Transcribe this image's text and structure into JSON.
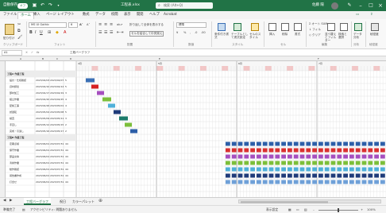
{
  "titlebar": {
    "autosave_label": "自動保存",
    "autosave_state": "オフ",
    "filename": "工程表.xlsx",
    "search_placeholder": "検索 (Alt+Q)",
    "user_name": "佐藤 陽"
  },
  "menu": [
    "ファイル",
    "ホーム",
    "挿入",
    "ページ レイアウト",
    "数式",
    "データ",
    "校閲",
    "表示",
    "開発",
    "ヘルプ",
    "Acrobat"
  ],
  "ribbon": {
    "paste_label": "貼り付け",
    "font_name": "MS UI Gothic",
    "font_size": "6",
    "wrap_text": "折り返して全体を表示する",
    "merge_center": "セルを結合して中央揃え",
    "number_format": "標準",
    "cond_format": "条件付き書式",
    "format_table": "テーブルとして書式設定",
    "cell_styles": "セルのスタイル",
    "insert": "挿入",
    "delete": "削除",
    "format": "書式",
    "autosum": "オート SUM",
    "fill": "フィル",
    "clear": "クリア",
    "sort_filter": "並べ替えとフィルター",
    "find_select": "検索と選択",
    "analyze": "データ分析",
    "sensitivity": "秘密度",
    "groups": [
      "クリップボード",
      "フォント",
      "配置",
      "数値",
      "スタイル",
      "セル",
      "編集",
      "分析",
      "秘密度"
    ]
  },
  "formula_bar": {
    "name_box": "A1",
    "fx": "fx",
    "content": "工程バーグラフ"
  },
  "sheet": {
    "col_headers": [
      "A",
      "B",
      "C",
      "D",
      "E",
      "F"
    ],
    "month_labels": [
      "4月",
      "5月",
      "6月",
      "7月"
    ],
    "rows": [
      {
        "label": "工程A\n作業工程",
        "bold": true
      },
      {
        "label": "設計・仕様確認",
        "start": "2023/04/03",
        "end": "2023/04/07",
        "days": "5"
      },
      {
        "label": "資材調達",
        "start": "2023/04/10",
        "end": "2023/04/14",
        "days": "5"
      },
      {
        "label": "部材加工",
        "start": "2023/04/17",
        "end": "2023/04/19",
        "days": "3"
      },
      {
        "label": "組立作業",
        "start": "2023/04/20",
        "end": "2023/04/25",
        "days": "4"
      },
      {
        "label": "配線工事",
        "start": "2023/04/26",
        "end": "2023/05/01",
        "days": "4"
      },
      {
        "label": "試運転",
        "start": "2023/05/02",
        "end": "2023/05/08",
        "days": "5"
      },
      {
        "label": "検査",
        "start": "2023/05/09",
        "end": "2023/05/11",
        "days": "3"
      },
      {
        "label": "手直し",
        "start": "2023/05/12",
        "end": "2023/05/15",
        "days": "2"
      },
      {
        "label": "完成・引渡し",
        "start": "2023/05/16",
        "end": "2023/05/17",
        "days": "2"
      },
      {
        "label": "工程B\n作業工程",
        "bold": true
      },
      {
        "label": "定期点検",
        "start": "2023/06/01",
        "end": "2023/07/31",
        "days": "44"
      },
      {
        "label": "保守作業",
        "start": "2023/06/01",
        "end": "2023/07/31",
        "days": "44"
      },
      {
        "label": "部品交換",
        "start": "2023/06/01",
        "end": "2023/07/31",
        "days": "44"
      },
      {
        "label": "清掃作業",
        "start": "2023/06/01",
        "end": "2023/07/31",
        "days": "44"
      },
      {
        "label": "動作確認",
        "start": "2023/06/01",
        "end": "2023/07/31",
        "days": "44"
      },
      {
        "label": "報告書作成",
        "start": "2023/06/01",
        "end": "2023/07/31",
        "days": "44"
      },
      {
        "label": "打合せ",
        "start": "2023/06/01",
        "end": "2023/07/31",
        "days": "44"
      }
    ]
  },
  "tabs": [
    "工程バーグラフ",
    "祝日",
    "カラーパレット"
  ],
  "status": {
    "ready": "準備完了",
    "accessibility": "アクセシビリティ: 問題ありません",
    "display_settings": "表示設定",
    "zoom": "100%"
  },
  "colors": {
    "excel_green": "#217346",
    "bars_a": [
      "#3a6fb5",
      "#d62222",
      "#a64fbf",
      "#7cbf3a",
      "#4fb0d9",
      "#1f3b7a",
      "#1b7a6a",
      "#7cbf3a",
      "#2d5fa8"
    ],
    "bars_b": [
      "#2d5fa8",
      "#d93030",
      "#a64fbf",
      "#7cbf3a",
      "#4fb0d9",
      "#1f3b7a",
      "#6fa0d8"
    ]
  }
}
